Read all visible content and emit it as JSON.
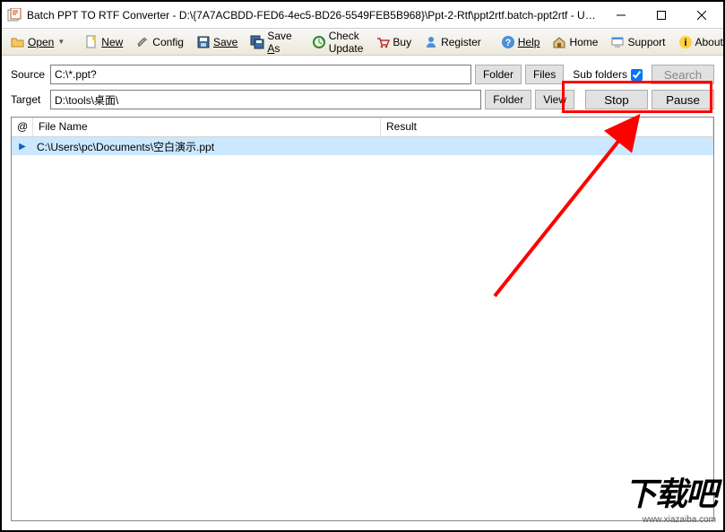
{
  "window": {
    "title": "Batch PPT TO RTF Converter - D:\\{7A7ACBDD-FED6-4ec5-BD26-5549FEB5B968}\\Ppt-2-Rtf\\ppt2rtf.batch-ppt2rtf - Unlice..."
  },
  "toolbar": {
    "open": "Open",
    "new": "New",
    "config": "Config",
    "save": "Save",
    "save_as": "Save As",
    "check_update": "Check Update",
    "buy": "Buy",
    "register": "Register",
    "help": "Help",
    "home": "Home",
    "support": "Support",
    "about": "About"
  },
  "paths": {
    "source_label": "Source",
    "source_value": "C:\\*.ppt?",
    "target_label": "Target",
    "target_value": "D:\\tools\\桌面\\",
    "folder_btn": "Folder",
    "files_btn": "Files",
    "view_btn": "View",
    "sub_folders_label": "Sub folders",
    "search_btn": "Search",
    "stop_btn": "Stop",
    "pause_btn": "Pause"
  },
  "list": {
    "col_at": "@",
    "col_filename": "File Name",
    "col_result": "Result",
    "rows": [
      {
        "marker": "▶",
        "filename": "C:\\Users\\pc\\Documents\\空白演示.ppt",
        "result": ""
      }
    ]
  },
  "watermark": {
    "main": "下载吧",
    "sub": "www.xiazaiba.com"
  }
}
